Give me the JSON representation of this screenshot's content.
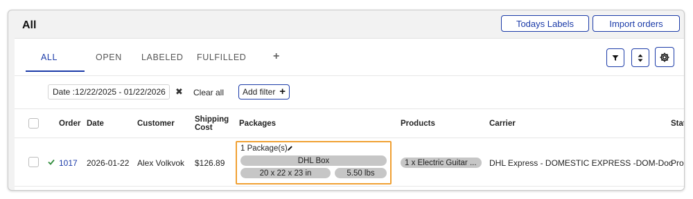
{
  "header": {
    "title": "All",
    "todays_labels": "Todays Labels",
    "import_orders": "Import orders"
  },
  "tabs": [
    {
      "label": "ALL",
      "active": true
    },
    {
      "label": "OPEN"
    },
    {
      "label": "LABELED"
    },
    {
      "label": "FULFILLED"
    },
    {
      "label": "+"
    }
  ],
  "toolbar_icons": [
    "filter-icon",
    "sort-icon",
    "gear-icon"
  ],
  "filters": {
    "date_chip": "Date :12/22/2025 - 01/22/2026",
    "clear_all": "Clear all",
    "add_filter": "Add filter"
  },
  "columns": {
    "order": "Order",
    "date": "Date",
    "customer": "Customer",
    "shipping_cost": "Shipping Cost",
    "packages": "Packages",
    "products": "Products",
    "carrier": "Carrier",
    "status": "Stat"
  },
  "rows": [
    {
      "order": "1017",
      "date": "2026-01-22",
      "customer": "Alex Volkvok",
      "shipping_cost": "$126.89",
      "packages": {
        "count": "1 Package(s)",
        "box": "DHL Box",
        "dims": "20 x 22 x 23 in",
        "weight": "5.50 lbs"
      },
      "product": "1 x Electric Guitar ...",
      "carrier": "DHL Express - DOMESTIC EXPRESS -DOM-Doc",
      "status": "Proc"
    }
  ],
  "colors": {
    "accent": "#1a3aa8",
    "highlight_border": "#f0a032",
    "check_green": "#2e8b3a",
    "pill_bg": "#c6c6c6"
  }
}
